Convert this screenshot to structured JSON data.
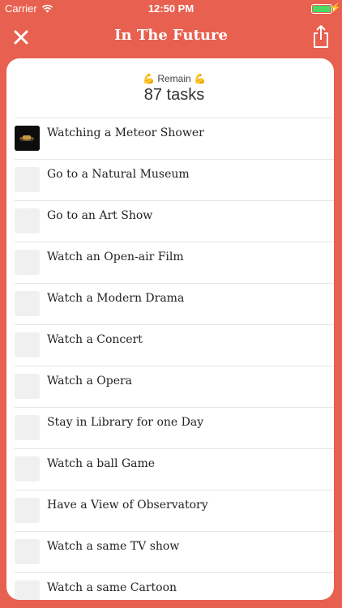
{
  "status_bar": {
    "carrier": "Carrier",
    "time": "12:50 PM"
  },
  "nav": {
    "title": "In The Future",
    "close_icon": "close-icon",
    "share_icon": "share-icon"
  },
  "header": {
    "remain_label": "💪 Remain 💪",
    "count_text": "87 tasks"
  },
  "tasks": [
    {
      "label": "Watching a Meteor Shower",
      "has_image": true
    },
    {
      "label": "Go to a Natural Museum",
      "has_image": false
    },
    {
      "label": "Go to an Art Show",
      "has_image": false
    },
    {
      "label": "Watch an Open-air Film",
      "has_image": false
    },
    {
      "label": "Watch a Modern Drama",
      "has_image": false
    },
    {
      "label": "Watch a Concert",
      "has_image": false
    },
    {
      "label": "Watch a Opera",
      "has_image": false
    },
    {
      "label": "Stay in Library for one Day",
      "has_image": false
    },
    {
      "label": "Watch a ball Game",
      "has_image": false
    },
    {
      "label": "Have a View of Observatory",
      "has_image": false
    },
    {
      "label": "Watch a same TV show",
      "has_image": false
    },
    {
      "label": "Watch a same Cartoon",
      "has_image": false
    }
  ],
  "colors": {
    "background": "#e8604f",
    "battery": "#4cd964"
  }
}
